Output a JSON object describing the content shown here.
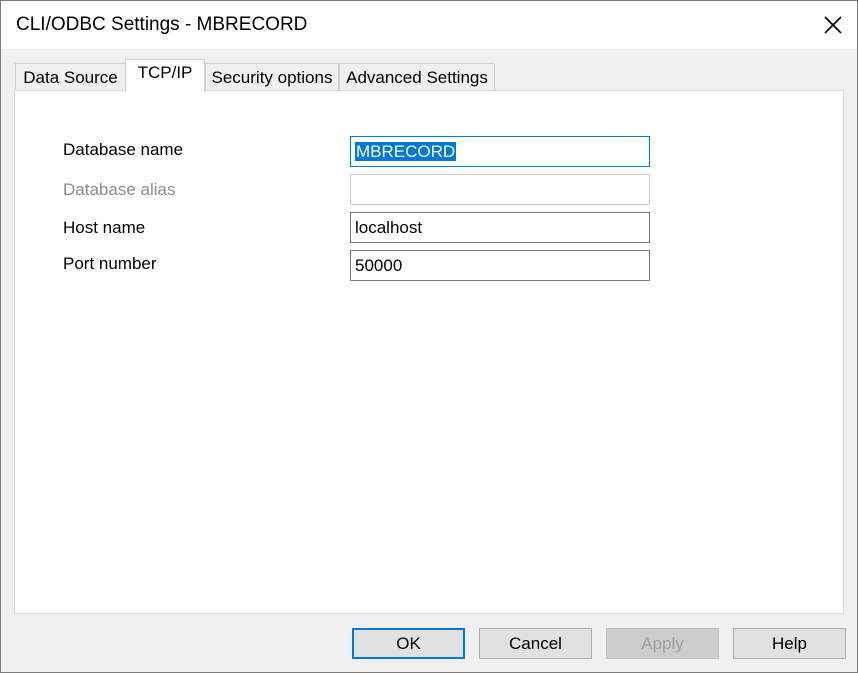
{
  "window": {
    "title": "CLI/ODBC Settings - MBRECORD"
  },
  "tabs": [
    {
      "label": "Data Source"
    },
    {
      "label": "TCP/IP"
    },
    {
      "label": "Security options"
    },
    {
      "label": "Advanced Settings"
    }
  ],
  "form": {
    "database_name": {
      "label": "Database name",
      "value": "MBRECORD"
    },
    "database_alias": {
      "label": "Database alias",
      "value": ""
    },
    "host_name": {
      "label": "Host name",
      "value": "localhost"
    },
    "port_number": {
      "label": "Port number",
      "value": "50000"
    }
  },
  "buttons": {
    "ok": "OK",
    "cancel": "Cancel",
    "apply": "Apply",
    "help": "Help"
  },
  "colors": {
    "accent": "#0078d7",
    "disabled_text": "#8c8c8c"
  }
}
